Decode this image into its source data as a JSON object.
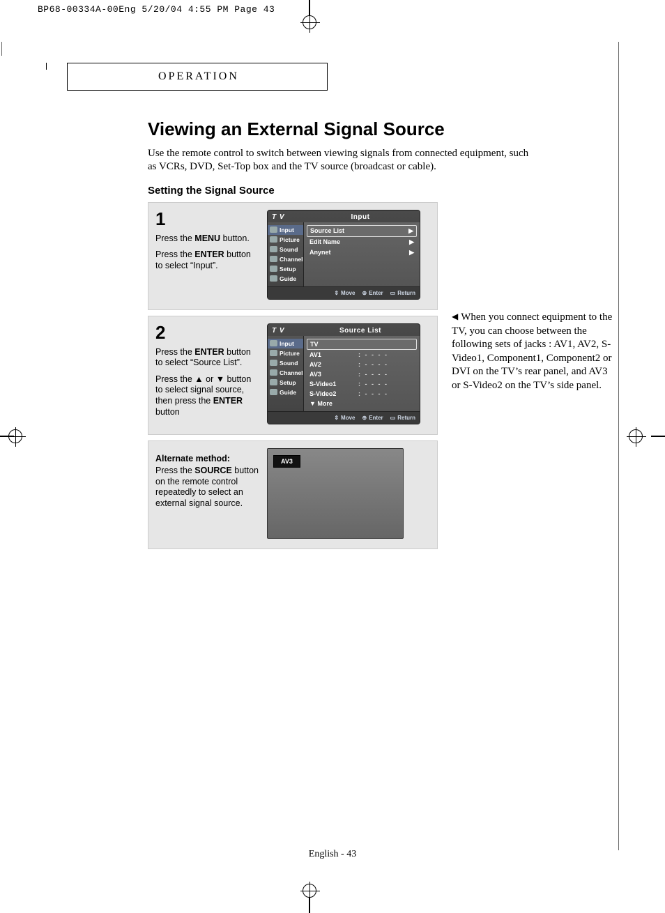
{
  "slug": "BP68-00334A-00Eng  5/20/04  4:55 PM  Page 43",
  "section_tab": "OPERATION",
  "title": "Viewing an External Signal Source",
  "intro": "Use the remote control to switch between viewing signals from connected equipment, such as VCRs, DVD, Set-Top box and the TV source (broadcast or cable).",
  "subhead": "Setting the Signal Source",
  "steps": {
    "s1": {
      "num": "1",
      "line1_a": "Press the ",
      "line1_b": "MENU",
      "line1_c": " button.",
      "line2_a": "Press the ",
      "line2_b": "ENTER",
      "line2_c": " button to select “Input”."
    },
    "s2": {
      "num": "2",
      "line1_a": "Press the ",
      "line1_b": "ENTER",
      "line1_c": " button to select “Source List”.",
      "line2_a": "Press the ▲ or ▼ button to select signal source, then press the ",
      "line2_b": "ENTER",
      "line2_c": " button"
    },
    "alt": {
      "head": "Alternate method:",
      "body_a": "Press the ",
      "body_b": "SOURCE",
      "body_c": " button on the remote control repeatedly to select an external signal source."
    }
  },
  "osd": {
    "tv": "T V",
    "title_input": "Input",
    "title_source": "Source List",
    "side": [
      "Input",
      "Picture",
      "Sound",
      "Channel",
      "Setup",
      "Guide"
    ],
    "foot": {
      "move": "Move",
      "enter": "Enter",
      "ret": "Return"
    },
    "panel1": [
      {
        "name": "Source List",
        "arrow": "▶",
        "boxed": true
      },
      {
        "name": "Edit Name",
        "arrow": "▶"
      },
      {
        "name": "Anynet",
        "arrow": "▶"
      }
    ],
    "panel2": [
      {
        "name": "TV",
        "val": "",
        "boxed": true
      },
      {
        "name": "AV1",
        "val": ": - - - -"
      },
      {
        "name": "AV2",
        "val": ": - - - -"
      },
      {
        "name": "AV3",
        "val": ": - - - -"
      },
      {
        "name": "S-Video1",
        "val": ": - - - -"
      },
      {
        "name": "S-Video2",
        "val": ": - - - -"
      }
    ],
    "more": "▼ More",
    "pill": "AV3"
  },
  "sidenote": "When you connect equipment to the TV, you can choose between the following sets of jacks : AV1, AV2, S-Video1, Component1, Component2 or DVI on the TV’s rear panel, and AV3 or S-Video2 on the TV’s side panel.",
  "footer": "English - 43"
}
